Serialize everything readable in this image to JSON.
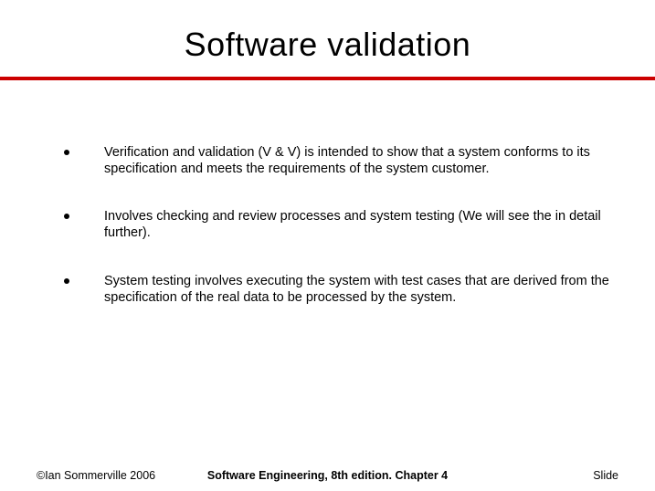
{
  "title": "Software validation",
  "bullets": [
    "Verification and validation (V & V) is intended to show that a system conforms to its specification and meets the requirements of the system customer.",
    "Involves checking and review processes and system testing (We will see the in detail further).",
    "System testing involves executing the system with test cases that are derived from the specification of the real data to be processed by the system."
  ],
  "footer": {
    "left": "©Ian Sommerville 2006",
    "center": "Software Engineering, 8th edition. Chapter 4",
    "right": "Slide"
  }
}
